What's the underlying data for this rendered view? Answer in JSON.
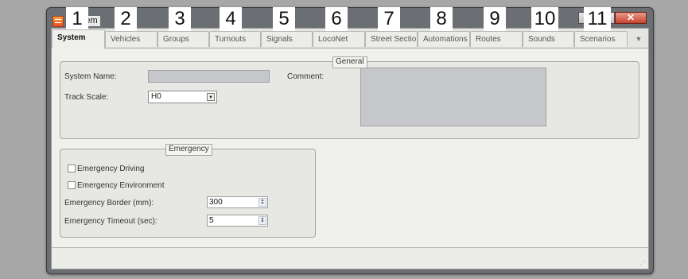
{
  "window": {
    "title": "System",
    "close_glyph": "✕"
  },
  "tabs": [
    {
      "label": "System",
      "active": true
    },
    {
      "label": "Vehicles",
      "active": false
    },
    {
      "label": "Groups",
      "active": false
    },
    {
      "label": "Turnouts",
      "active": false
    },
    {
      "label": "Signals",
      "active": false
    },
    {
      "label": "LocoNet",
      "active": false
    },
    {
      "label": "Street Sectio..",
      "active": false
    },
    {
      "label": "Automations",
      "active": false
    },
    {
      "label": "Routes",
      "active": false
    },
    {
      "label": "Sounds",
      "active": false
    },
    {
      "label": "Scenarios",
      "active": false
    }
  ],
  "tab_scroll_glyph": "▼",
  "overlay_numbers": [
    "1",
    "2",
    "3",
    "4",
    "5",
    "6",
    "7",
    "8",
    "9",
    "10",
    "11"
  ],
  "general": {
    "title": "General",
    "system_name_label": "System Name:",
    "system_name_value": "",
    "comment_label": "Comment:",
    "comment_value": "",
    "track_scale_label": "Track Scale:",
    "track_scale_value": "H0"
  },
  "emergency": {
    "title": "Emergency",
    "driving_label": "Emergency Driving",
    "driving_checked": false,
    "environment_label": "Emergency Environment",
    "environment_checked": false,
    "border_label": "Emergency Border (mm):",
    "border_value": "300",
    "timeout_label": "Emergency Timeout (sec):",
    "timeout_value": "5"
  },
  "icons": {
    "app": "system-app-icon",
    "dropdown": "chevron-down-icon",
    "spinner": "spinner-arrows-icon",
    "grip": "resize-grip-icon"
  },
  "colors": {
    "page_background": "#a7a7a7",
    "window_frame": "#6b6f73",
    "close_button": "#c74430",
    "textbox_fill": "#c5c7cb"
  }
}
